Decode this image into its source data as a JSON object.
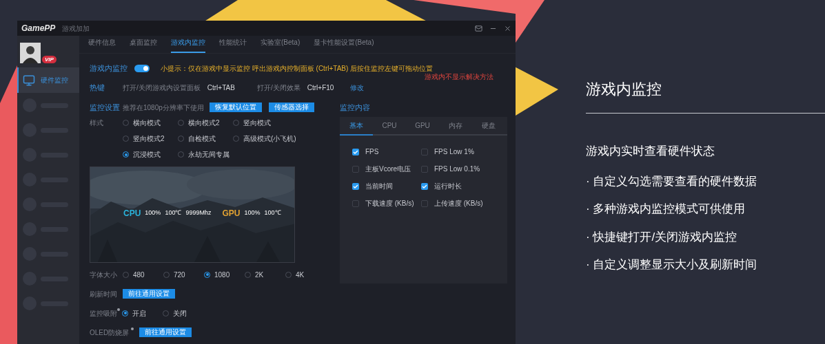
{
  "window": {
    "logo": "GamePP",
    "title": "游戏加加"
  },
  "user": {
    "badge": "VIP"
  },
  "sidebar": {
    "items": [
      {
        "kind": "item",
        "label": "硬件监控",
        "selected": true
      },
      {
        "kind": "placeholder",
        "selected": false
      },
      {
        "kind": "placeholder",
        "selected": false
      },
      {
        "kind": "placeholder",
        "selected": false
      },
      {
        "kind": "placeholder",
        "selected": false
      },
      {
        "kind": "placeholder",
        "selected": false
      },
      {
        "kind": "placeholder",
        "selected": false
      },
      {
        "kind": "placeholder",
        "selected": false
      },
      {
        "kind": "placeholder",
        "selected": false
      },
      {
        "kind": "placeholder",
        "selected": false
      }
    ]
  },
  "tabs": [
    {
      "label": "硬件信息",
      "selected": false
    },
    {
      "label": "桌面监控",
      "selected": false
    },
    {
      "label": "游戏内监控",
      "selected": true
    },
    {
      "label": "性能统计",
      "selected": false
    },
    {
      "label": "实验室(Beta)",
      "selected": false
    },
    {
      "label": "显卡性能设置(Beta)",
      "selected": false
    }
  ],
  "overlay_toggle": {
    "label": "游戏内监控",
    "on": true
  },
  "tip": "小提示：仅在游戏中显示监控 呼出游戏内控制面板 (Ctrl+TAB) 后按住监控左键可拖动位置",
  "help_link": "游戏内不显示解决方法",
  "hotkeys": {
    "label": "热键",
    "items": [
      {
        "action": "打开/关闭游戏内设置面板",
        "key": "Ctrl+TAB"
      },
      {
        "action": "打开/关闭效果",
        "key": "Ctrl+F10"
      }
    ],
    "edit_link": "修改"
  },
  "monitor_settings": {
    "label": "监控设置",
    "note": "推荐在1080p分辨率下使用",
    "buttons": [
      "恢复默认位置",
      "传感器选择"
    ]
  },
  "style": {
    "label": "样式",
    "options": [
      {
        "label": "横向模式",
        "selected": false
      },
      {
        "label": "横向模式2",
        "selected": false
      },
      {
        "label": "竖向模式",
        "selected": false
      },
      {
        "label": "竖向模式2",
        "selected": false
      },
      {
        "label": "自检模式",
        "selected": false
      },
      {
        "label": "高级模式(小飞机)",
        "selected": false
      },
      {
        "label": "沉浸模式",
        "selected": true
      },
      {
        "label": "永劫无间专属",
        "selected": false
      }
    ]
  },
  "preview": {
    "kind": "picture",
    "groups": [
      {
        "name": "CPU",
        "color": "#2ab4dc",
        "values": [
          "100%",
          "100℃",
          "9999Mhz"
        ]
      },
      {
        "name": "GPU",
        "color": "#e2a232",
        "values": [
          "100%",
          "100℃"
        ]
      }
    ]
  },
  "font_size": {
    "label": "字体大小",
    "options": [
      {
        "label": "480",
        "selected": false
      },
      {
        "label": "720",
        "selected": false
      },
      {
        "label": "1080",
        "selected": true
      },
      {
        "label": "2K",
        "selected": false
      },
      {
        "label": "4K",
        "selected": false
      }
    ]
  },
  "refresh": {
    "label": "刷新时间",
    "button": "前往通用设置"
  },
  "snap": {
    "label": "监控吸附",
    "options": [
      {
        "label": "开启",
        "selected": true
      },
      {
        "label": "关闭",
        "selected": false
      }
    ]
  },
  "oled": {
    "label": "OLED防烧屏",
    "button": "前往通用设置"
  },
  "content": {
    "label": "监控内容",
    "tabs": [
      {
        "label": "基本",
        "selected": true
      },
      {
        "label": "CPU",
        "selected": false
      },
      {
        "label": "GPU",
        "selected": false
      },
      {
        "label": "内存",
        "selected": false
      },
      {
        "label": "硬盘",
        "selected": false
      }
    ],
    "items": [
      {
        "label": "FPS",
        "checked": true
      },
      {
        "label": "FPS Low 1%",
        "checked": false
      },
      {
        "label": "主板Vcore电压",
        "checked": false
      },
      {
        "label": "FPS Low 0.1%",
        "checked": false
      },
      {
        "label": "当前时间",
        "checked": true
      },
      {
        "label": "运行时长",
        "checked": true
      },
      {
        "label": "下载速度 (KB/s)",
        "checked": false
      },
      {
        "label": "上传速度 (KB/s)",
        "checked": false
      }
    ]
  },
  "slide": {
    "heading": "游戏内监控",
    "subtitle": "游戏内实时查看硬件状态",
    "bullets": [
      "· 自定义勾选需要查看的硬件数据",
      "· 多种游戏内监控模式可供使用",
      "· 快捷键打开/关闭游戏内监控",
      "· 自定义调整显示大小及刷新时间"
    ]
  }
}
